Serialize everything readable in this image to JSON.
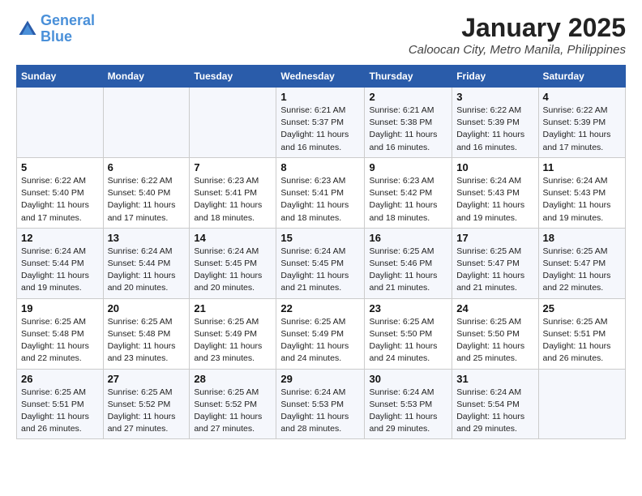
{
  "logo": {
    "line1": "General",
    "line2": "Blue"
  },
  "title": "January 2025",
  "location": "Caloocan City, Metro Manila, Philippines",
  "weekdays": [
    "Sunday",
    "Monday",
    "Tuesday",
    "Wednesday",
    "Thursday",
    "Friday",
    "Saturday"
  ],
  "weeks": [
    [
      {
        "day": "",
        "sunrise": "",
        "sunset": "",
        "daylight": ""
      },
      {
        "day": "",
        "sunrise": "",
        "sunset": "",
        "daylight": ""
      },
      {
        "day": "",
        "sunrise": "",
        "sunset": "",
        "daylight": ""
      },
      {
        "day": "1",
        "sunrise": "Sunrise: 6:21 AM",
        "sunset": "Sunset: 5:37 PM",
        "daylight": "Daylight: 11 hours and 16 minutes."
      },
      {
        "day": "2",
        "sunrise": "Sunrise: 6:21 AM",
        "sunset": "Sunset: 5:38 PM",
        "daylight": "Daylight: 11 hours and 16 minutes."
      },
      {
        "day": "3",
        "sunrise": "Sunrise: 6:22 AM",
        "sunset": "Sunset: 5:39 PM",
        "daylight": "Daylight: 11 hours and 16 minutes."
      },
      {
        "day": "4",
        "sunrise": "Sunrise: 6:22 AM",
        "sunset": "Sunset: 5:39 PM",
        "daylight": "Daylight: 11 hours and 17 minutes."
      }
    ],
    [
      {
        "day": "5",
        "sunrise": "Sunrise: 6:22 AM",
        "sunset": "Sunset: 5:40 PM",
        "daylight": "Daylight: 11 hours and 17 minutes."
      },
      {
        "day": "6",
        "sunrise": "Sunrise: 6:22 AM",
        "sunset": "Sunset: 5:40 PM",
        "daylight": "Daylight: 11 hours and 17 minutes."
      },
      {
        "day": "7",
        "sunrise": "Sunrise: 6:23 AM",
        "sunset": "Sunset: 5:41 PM",
        "daylight": "Daylight: 11 hours and 18 minutes."
      },
      {
        "day": "8",
        "sunrise": "Sunrise: 6:23 AM",
        "sunset": "Sunset: 5:41 PM",
        "daylight": "Daylight: 11 hours and 18 minutes."
      },
      {
        "day": "9",
        "sunrise": "Sunrise: 6:23 AM",
        "sunset": "Sunset: 5:42 PM",
        "daylight": "Daylight: 11 hours and 18 minutes."
      },
      {
        "day": "10",
        "sunrise": "Sunrise: 6:24 AM",
        "sunset": "Sunset: 5:43 PM",
        "daylight": "Daylight: 11 hours and 19 minutes."
      },
      {
        "day": "11",
        "sunrise": "Sunrise: 6:24 AM",
        "sunset": "Sunset: 5:43 PM",
        "daylight": "Daylight: 11 hours and 19 minutes."
      }
    ],
    [
      {
        "day": "12",
        "sunrise": "Sunrise: 6:24 AM",
        "sunset": "Sunset: 5:44 PM",
        "daylight": "Daylight: 11 hours and 19 minutes."
      },
      {
        "day": "13",
        "sunrise": "Sunrise: 6:24 AM",
        "sunset": "Sunset: 5:44 PM",
        "daylight": "Daylight: 11 hours and 20 minutes."
      },
      {
        "day": "14",
        "sunrise": "Sunrise: 6:24 AM",
        "sunset": "Sunset: 5:45 PM",
        "daylight": "Daylight: 11 hours and 20 minutes."
      },
      {
        "day": "15",
        "sunrise": "Sunrise: 6:24 AM",
        "sunset": "Sunset: 5:45 PM",
        "daylight": "Daylight: 11 hours and 21 minutes."
      },
      {
        "day": "16",
        "sunrise": "Sunrise: 6:25 AM",
        "sunset": "Sunset: 5:46 PM",
        "daylight": "Daylight: 11 hours and 21 minutes."
      },
      {
        "day": "17",
        "sunrise": "Sunrise: 6:25 AM",
        "sunset": "Sunset: 5:47 PM",
        "daylight": "Daylight: 11 hours and 21 minutes."
      },
      {
        "day": "18",
        "sunrise": "Sunrise: 6:25 AM",
        "sunset": "Sunset: 5:47 PM",
        "daylight": "Daylight: 11 hours and 22 minutes."
      }
    ],
    [
      {
        "day": "19",
        "sunrise": "Sunrise: 6:25 AM",
        "sunset": "Sunset: 5:48 PM",
        "daylight": "Daylight: 11 hours and 22 minutes."
      },
      {
        "day": "20",
        "sunrise": "Sunrise: 6:25 AM",
        "sunset": "Sunset: 5:48 PM",
        "daylight": "Daylight: 11 hours and 23 minutes."
      },
      {
        "day": "21",
        "sunrise": "Sunrise: 6:25 AM",
        "sunset": "Sunset: 5:49 PM",
        "daylight": "Daylight: 11 hours and 23 minutes."
      },
      {
        "day": "22",
        "sunrise": "Sunrise: 6:25 AM",
        "sunset": "Sunset: 5:49 PM",
        "daylight": "Daylight: 11 hours and 24 minutes."
      },
      {
        "day": "23",
        "sunrise": "Sunrise: 6:25 AM",
        "sunset": "Sunset: 5:50 PM",
        "daylight": "Daylight: 11 hours and 24 minutes."
      },
      {
        "day": "24",
        "sunrise": "Sunrise: 6:25 AM",
        "sunset": "Sunset: 5:50 PM",
        "daylight": "Daylight: 11 hours and 25 minutes."
      },
      {
        "day": "25",
        "sunrise": "Sunrise: 6:25 AM",
        "sunset": "Sunset: 5:51 PM",
        "daylight": "Daylight: 11 hours and 26 minutes."
      }
    ],
    [
      {
        "day": "26",
        "sunrise": "Sunrise: 6:25 AM",
        "sunset": "Sunset: 5:51 PM",
        "daylight": "Daylight: 11 hours and 26 minutes."
      },
      {
        "day": "27",
        "sunrise": "Sunrise: 6:25 AM",
        "sunset": "Sunset: 5:52 PM",
        "daylight": "Daylight: 11 hours and 27 minutes."
      },
      {
        "day": "28",
        "sunrise": "Sunrise: 6:25 AM",
        "sunset": "Sunset: 5:52 PM",
        "daylight": "Daylight: 11 hours and 27 minutes."
      },
      {
        "day": "29",
        "sunrise": "Sunrise: 6:24 AM",
        "sunset": "Sunset: 5:53 PM",
        "daylight": "Daylight: 11 hours and 28 minutes."
      },
      {
        "day": "30",
        "sunrise": "Sunrise: 6:24 AM",
        "sunset": "Sunset: 5:53 PM",
        "daylight": "Daylight: 11 hours and 29 minutes."
      },
      {
        "day": "31",
        "sunrise": "Sunrise: 6:24 AM",
        "sunset": "Sunset: 5:54 PM",
        "daylight": "Daylight: 11 hours and 29 minutes."
      },
      {
        "day": "",
        "sunrise": "",
        "sunset": "",
        "daylight": ""
      }
    ]
  ]
}
